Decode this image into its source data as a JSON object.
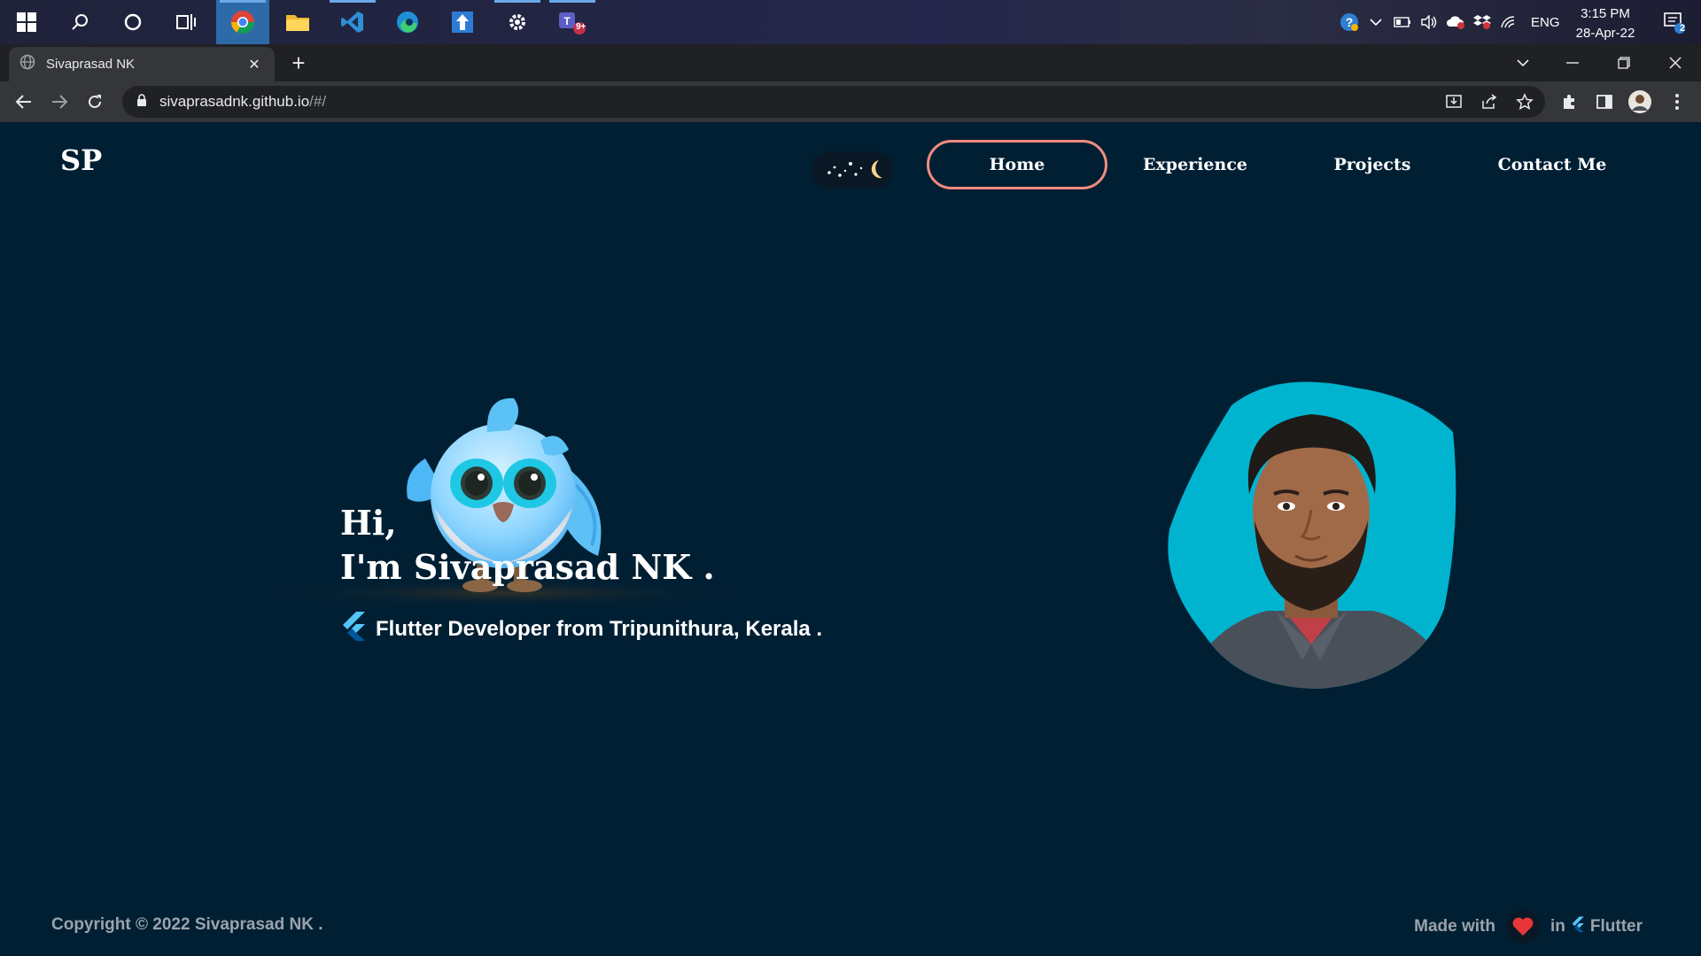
{
  "taskbar": {
    "apps": [
      {
        "name": "windows-start-icon"
      },
      {
        "name": "search-icon"
      },
      {
        "name": "cortana-icon"
      },
      {
        "name": "task-view-icon"
      },
      {
        "name": "chrome-icon"
      },
      {
        "name": "file-explorer-icon"
      },
      {
        "name": "vscode-icon"
      },
      {
        "name": "edge-icon"
      },
      {
        "name": "app-arrow-icon"
      },
      {
        "name": "settings-icon"
      },
      {
        "name": "teams-icon",
        "badge": "9+"
      }
    ],
    "language": "ENG",
    "time": "3:15 PM",
    "date": "28-Apr-22",
    "notification_count": "2"
  },
  "browser": {
    "tab_title": "Sivaprasad NK",
    "url_host": "sivaprasadnk.github.io",
    "url_path": "/#/"
  },
  "site": {
    "logo": "SP",
    "nav": {
      "home": "Home",
      "experience": "Experience",
      "projects": "Projects",
      "contact": "Contact Me"
    },
    "hero": {
      "greeting": "Hi,",
      "name": "I'm Sivaprasad NK .",
      "tagline": "Flutter Developer from Tripunithura, Kerala ."
    },
    "footer": {
      "copyright": "Copyright © 2022 Sivaprasad NK .",
      "made_with": "Made with",
      "in": "in",
      "flutter": "Flutter"
    },
    "colors": {
      "background": "#011f33",
      "accent": "#f28c7e",
      "blob": "#00b4d0",
      "heart": "#e8353a"
    }
  }
}
